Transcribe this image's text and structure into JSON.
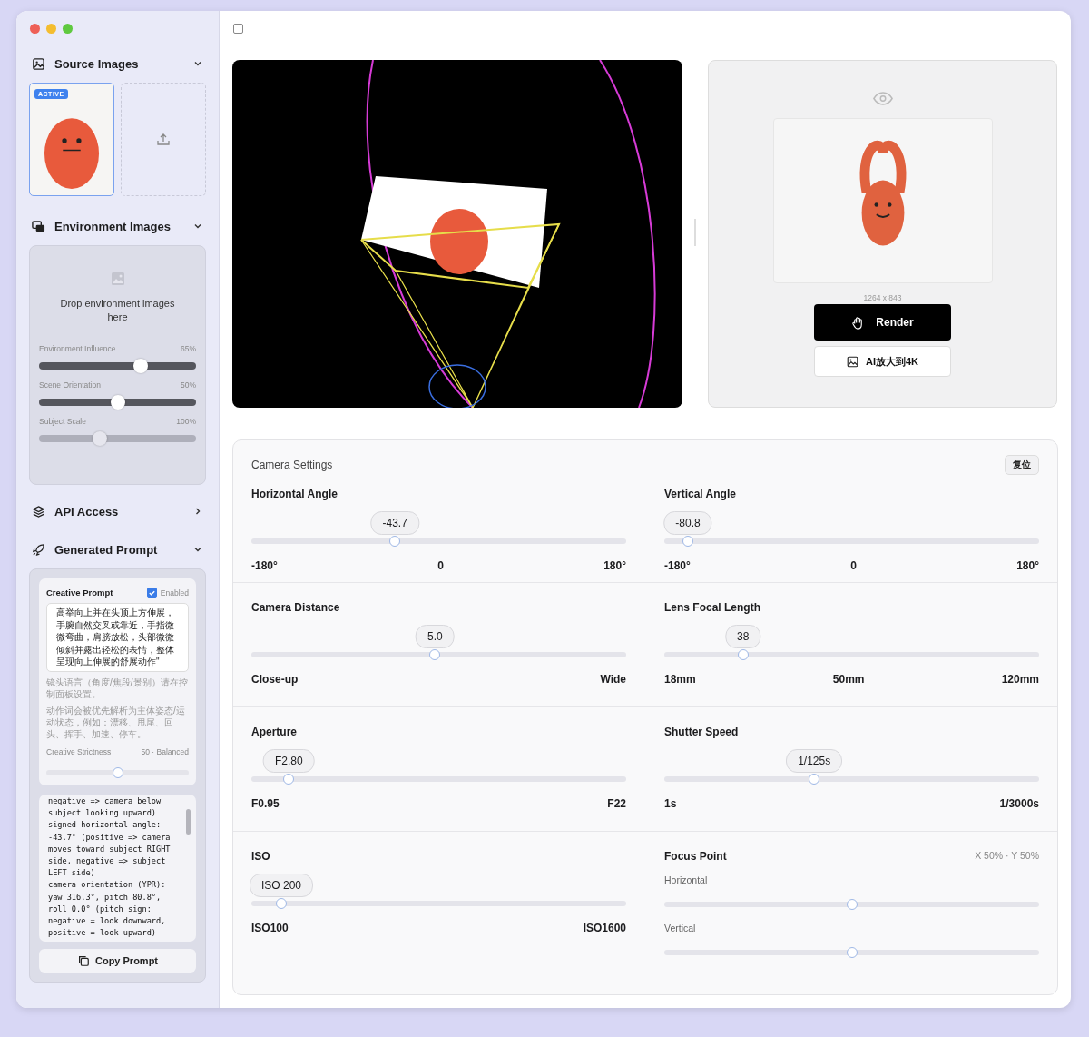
{
  "sidebar": {
    "source_images": {
      "title": "Source Images",
      "expanded": true,
      "thumbnails": [
        {
          "badge": "ACTIVE",
          "selected": true
        }
      ]
    },
    "environment_images": {
      "title": "Environment Images",
      "expanded": true,
      "dropzone_text": "Drop environment images here",
      "sliders": [
        {
          "label": "Environment Influence",
          "reading": "65%",
          "level": 0.65,
          "disabled": false
        },
        {
          "label": "Scene Orientation",
          "reading": "50%",
          "level": 0.5,
          "disabled": false
        },
        {
          "label": "Subject Scale",
          "reading": "100%",
          "level": 0.39,
          "disabled": true
        }
      ]
    },
    "api_access": {
      "title": "API Access",
      "expanded": false
    },
    "generated_prompt": {
      "title": "Generated Prompt",
      "expanded": true,
      "creative_prompt": {
        "title": "Creative Prompt",
        "enabled": {
          "label": "Enabled",
          "checked": true
        },
        "text": "高举向上并在头顶上方伸展，手腕自然交叉或靠近，手指微微弯曲，肩膀放松，头部微微倾斜并露出轻松的表情，整体呈现向上伸展的舒展动作\"",
        "notes": [
          "镜头语言（角度/焦段/景别）请在控制面板设置。",
          "动作词会被优先解析为主体姿态/运动状态，例如：漂移、甩尾、回头、挥手、加速、停车。"
        ],
        "strictness": {
          "label": "Creative Strictness",
          "reading": "50 · Balanced",
          "level": 0.5
        }
      },
      "output_lines": [
        "negative => camera below",
        "subject looking upward)",
        "signed horizontal angle:",
        "-43.7° (positive => camera",
        "moves toward subject RIGHT",
        "side, negative => subject",
        "LEFT side)",
        "camera orientation (YPR):",
        "yaw 316.3°, pitch 80.8°,",
        "roll 0.0° (pitch sign:",
        "negative = look downward,",
        "positive = look upward)"
      ],
      "copy_button": "Copy Prompt"
    }
  },
  "view_toggle": {
    "checked": false
  },
  "preview": {
    "image_size": "1264 x 843",
    "render_button": "Render",
    "upscale_button": "AI放大到4K"
  },
  "camera_settings": {
    "title": "Camera Settings",
    "reset_button": "复位",
    "controls": [
      {
        "kind": "slider",
        "label": "Horizontal Angle",
        "reading": "-43.7",
        "level": 0.383,
        "ticks": [
          "-180°",
          "0",
          "180°"
        ]
      },
      {
        "kind": "slider",
        "label": "Vertical Angle",
        "reading": "-80.8",
        "level": 0.063,
        "ticks": [
          "-180°",
          "0",
          "180°"
        ]
      },
      {
        "kind": "slider",
        "label": "Camera Distance",
        "reading": "5.0",
        "level": 0.49,
        "ticks": [
          "Close-up",
          "Wide"
        ]
      },
      {
        "kind": "slider",
        "label": "Lens Focal Length",
        "reading": "38",
        "level": 0.21,
        "ticks": [
          "18mm",
          "50mm",
          "120mm"
        ]
      },
      {
        "kind": "slider",
        "label": "Aperture",
        "reading": "F2.80",
        "level": 0.1,
        "ticks": [
          "F0.95",
          "F22"
        ]
      },
      {
        "kind": "slider",
        "label": "Shutter Speed",
        "reading": "1/125s",
        "level": 0.4,
        "ticks": [
          "1s",
          "1/3000s"
        ]
      },
      {
        "kind": "slider",
        "label": "ISO",
        "reading": "ISO 200",
        "level": 0.08,
        "ticks": [
          "ISO100",
          "ISO1600"
        ]
      },
      {
        "kind": "focus",
        "label": "Focus Point",
        "reading": "X 50% · Y 50%",
        "axes": [
          {
            "label": "Horizontal",
            "level": 0.5
          },
          {
            "label": "Vertical",
            "level": 0.5
          }
        ]
      }
    ]
  }
}
